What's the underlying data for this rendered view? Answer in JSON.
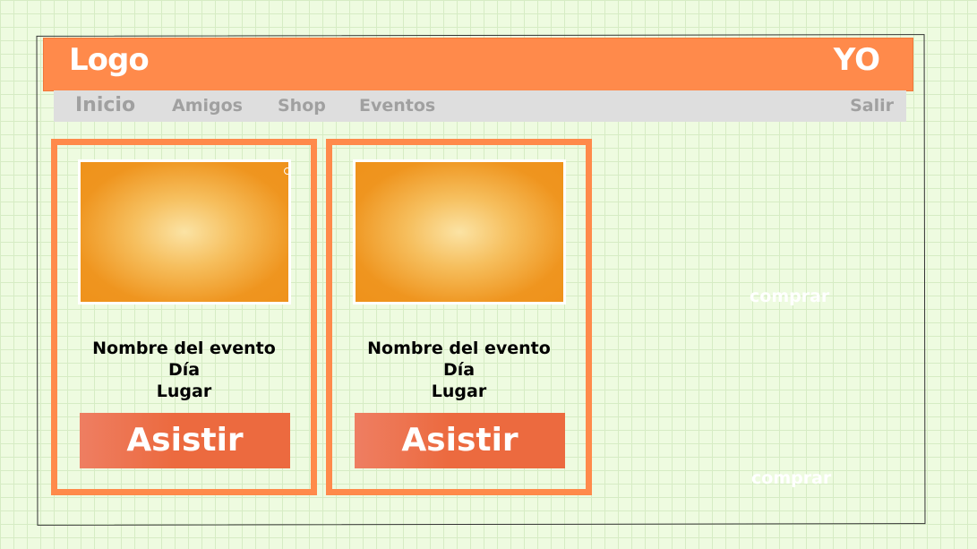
{
  "header": {
    "logo": "Logo",
    "user": "YO"
  },
  "nav": {
    "items": [
      {
        "label": "Inicio"
      },
      {
        "label": "Amigos"
      },
      {
        "label": "Shop"
      },
      {
        "label": "Eventos"
      }
    ],
    "logout": "Salir"
  },
  "events": [
    {
      "name": "Nombre del evento",
      "day": "Día",
      "place": "Lugar",
      "button": "Asistir"
    },
    {
      "name": "Nombre del evento",
      "day": "Día",
      "place": "Lugar",
      "button": "Asistir"
    }
  ],
  "buy_links": [
    "comprar",
    "comprar"
  ]
}
